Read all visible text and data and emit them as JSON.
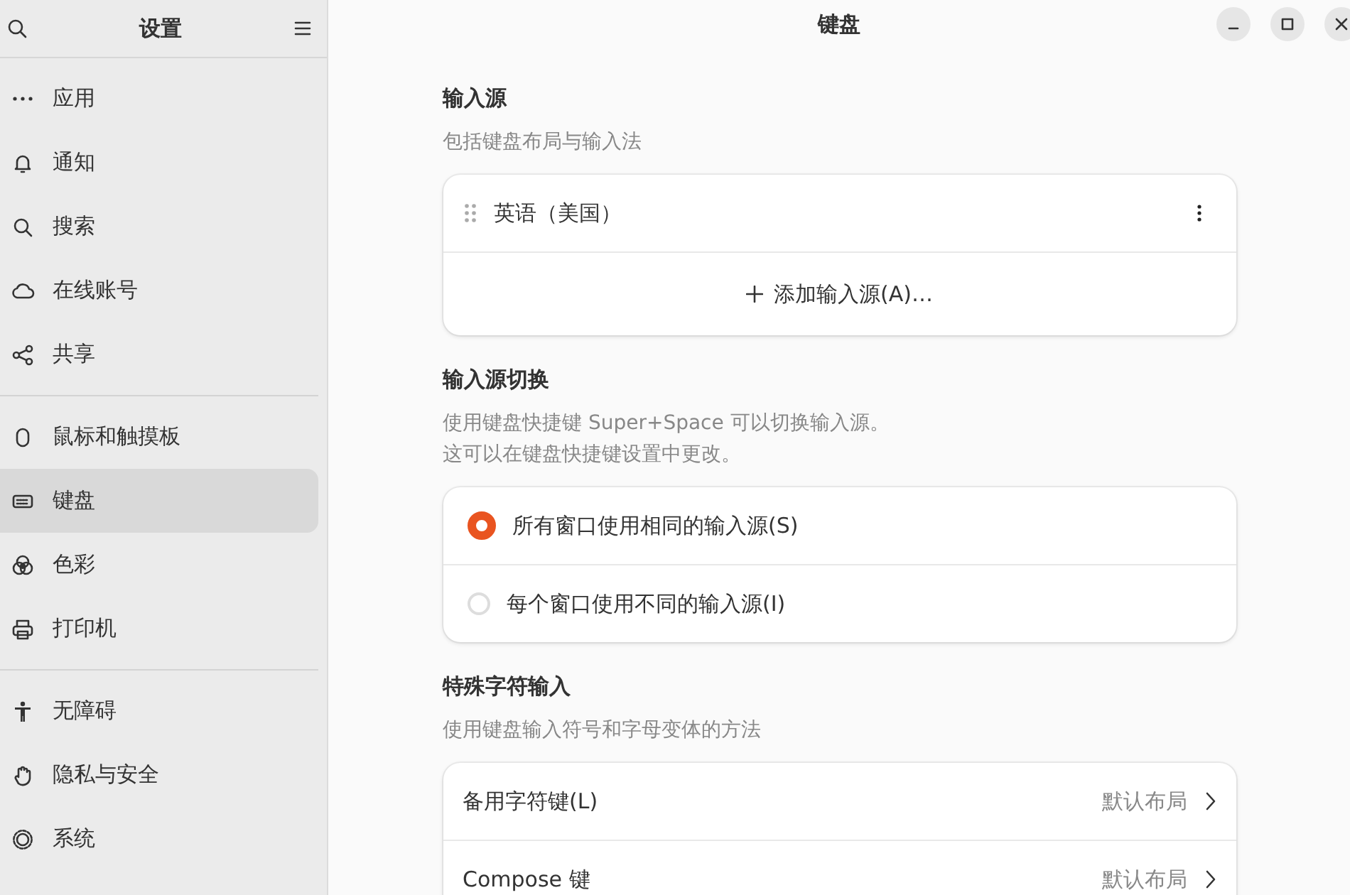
{
  "sidebar": {
    "title": "设置",
    "groups": [
      {
        "items": [
          {
            "label": "应用",
            "selected": false
          },
          {
            "label": "通知",
            "selected": false
          },
          {
            "label": "搜索",
            "selected": false
          },
          {
            "label": "在线账号",
            "selected": false
          },
          {
            "label": "共享",
            "selected": false
          }
        ]
      },
      {
        "items": [
          {
            "label": "鼠标和触摸板",
            "selected": false
          },
          {
            "label": "键盘",
            "selected": true
          },
          {
            "label": "色彩",
            "selected": false
          },
          {
            "label": "打印机",
            "selected": false
          }
        ]
      },
      {
        "items": [
          {
            "label": "无障碍",
            "selected": false
          },
          {
            "label": "隐私与安全",
            "selected": false
          },
          {
            "label": "系统",
            "selected": false
          }
        ]
      }
    ]
  },
  "window": {
    "title": "键盘"
  },
  "sections": [
    {
      "heading": "输入源",
      "description_lines": [
        "包括键盘布局与输入法"
      ],
      "rows": [
        {
          "kind": "source",
          "label": "英语（美国）"
        },
        {
          "kind": "add",
          "label": "添加输入源(A)…"
        }
      ]
    },
    {
      "heading": "输入源切换",
      "description_lines": [
        "使用键盘快捷键 Super+Space 可以切换输入源。",
        "这可以在键盘快捷键设置中更改。"
      ],
      "rows": [
        {
          "kind": "radio",
          "label": "所有窗口使用相同的输入源(S)",
          "selected": true
        },
        {
          "kind": "radio",
          "label": "每个窗口使用不同的输入源(I)",
          "selected": false
        }
      ]
    },
    {
      "heading": "特殊字符输入",
      "description_lines": [
        "使用键盘输入符号和字母变体的方法"
      ],
      "rows": [
        {
          "kind": "nav",
          "label": "备用字符键(L)",
          "value": "默认布局"
        },
        {
          "kind": "nav",
          "label": "Compose 键",
          "value": "默认布局"
        }
      ]
    }
  ]
}
